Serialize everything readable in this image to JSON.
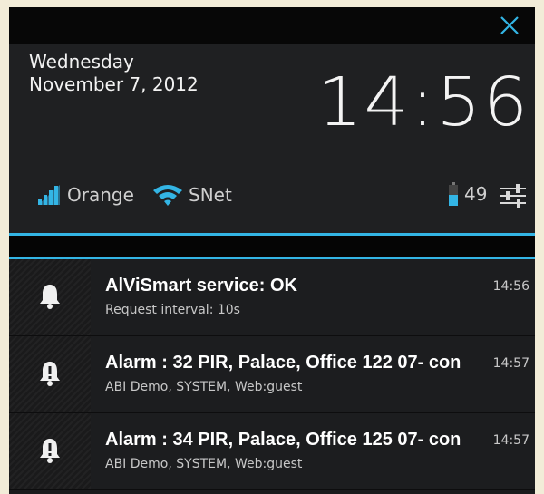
{
  "header": {
    "day": "Wednesday",
    "date": "November 7, 2012",
    "clock": "14:56"
  },
  "status": {
    "carrier": "Orange",
    "wifi": "SNet",
    "battery": "49"
  },
  "notifications": [
    {
      "title": "AlViSmart service: OK",
      "subtitle": "Request interval: 10s",
      "time": "14:56",
      "icon": "bell-icon"
    },
    {
      "title": "Alarm : 32 PIR, Palace, Office 122 07- con",
      "subtitle": "ABI Demo, SYSTEM, Web:guest",
      "time": "14:57",
      "icon": "alarm-bell-icon"
    },
    {
      "title": "Alarm : 34 PIR, Palace, Office 125 07- con",
      "subtitle": "ABI Demo, SYSTEM, Web:guest",
      "time": "14:57",
      "icon": "alarm-bell-icon"
    }
  ],
  "colors": {
    "accent": "#33b5e5",
    "panel": "#1f2022",
    "background": "#f2ecd8"
  }
}
